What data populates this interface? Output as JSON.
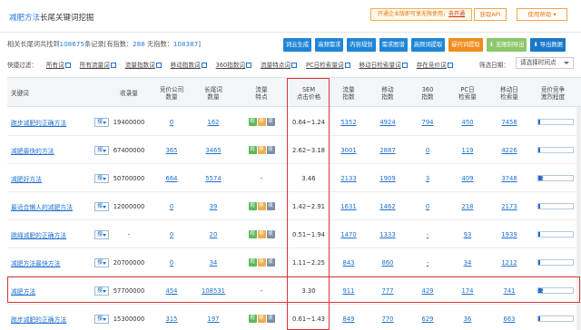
{
  "header": {
    "title_highlight": "减肥方法",
    "title_rest": "长尾关键词挖掘",
    "promo_text": "开通企业版即可享无限使用，",
    "promo_link": "去开通",
    "api_button": "获取API",
    "help_button": "使用帮助"
  },
  "summary": {
    "prefix": "相关长尾词共找到",
    "total": "108675",
    "middle": "条记录[有指数：",
    "with_index": "288",
    "middle2": " 无指数：",
    "without_index": "108387",
    "suffix": "]"
  },
  "actions": [
    "词云生成",
    "高频需求",
    "内容规划",
    "需求图谱",
    "高频词提取",
    "疑问词提取",
    "无限制导出",
    "导出数据"
  ],
  "filters": {
    "label": "快捷过滤：",
    "items": [
      "所有词",
      "所有流量词",
      "流量指数词",
      "移动指数词",
      "360指数词",
      "流量特点词",
      "PC日检索量词",
      "移动日检索量词",
      "存在竞价词"
    ]
  },
  "sort": {
    "label": "筛选日期：",
    "value": "请选择时间点"
  },
  "columns": {
    "keyword": "关键词",
    "records": "收录量",
    "bid_count": "竞价公司\n数量",
    "longtail": "长尾词\n数量",
    "traffic_feature": "流量\n特点",
    "sem": "SEM\n点击价格",
    "traffic_index": "流量\n指数",
    "mobile_index": "移动\n指数",
    "idx360": "360\n指数",
    "pc_daily": "PC日\n检索量",
    "mobile_daily": "移动日\n检索量",
    "competition": "竞价竞争\n激烈程度"
  },
  "rows": [
    {
      "keyword": "跑步减肥的正确方法",
      "dd": "搜",
      "records": "19400000",
      "bid": "0",
      "longtail": "162",
      "tags": [
        "视",
        "移",
        "夜"
      ],
      "sem": "0.64~1.24",
      "traffic": "5352",
      "mobile": "4924",
      "i360": "794",
      "pc": "450",
      "mdaily": "7458",
      "comp_label": "1",
      "comp": 0.06
    },
    {
      "keyword": "减肥最快的方法",
      "dd": "搜",
      "records": "67400000",
      "bid": "365",
      "longtail": "3465",
      "tags": [
        "视",
        "移",
        "夜"
      ],
      "sem": "2.62~3.18",
      "traffic": "3001",
      "mobile": "2887",
      "i360": "0",
      "pc": "119",
      "mdaily": "4226",
      "comp_label": "1",
      "comp": 0.06
    },
    {
      "keyword": "减肥好方法",
      "dd": "搜",
      "records": "50700000",
      "bid": "664",
      "longtail": "5574",
      "tags": [],
      "sem": "3.46",
      "traffic": "2133",
      "mobile": "1909",
      "i360": "3",
      "pc": "409",
      "mdaily": "3748",
      "comp_label": "2",
      "comp": 0.12
    },
    {
      "keyword": "最适合懒人的减肥方法",
      "dd": "搜",
      "records": "12000000",
      "bid": "0",
      "longtail": "39",
      "tags": [
        "视",
        "移",
        "夜"
      ],
      "sem": "1.42~2.91",
      "traffic": "1631",
      "mobile": "1462",
      "i360": "0",
      "pc": "218",
      "mdaily": "2173",
      "comp_label": "1",
      "comp": 0.06
    },
    {
      "keyword": "跳绳减肥的正确方法",
      "dd": "搜",
      "records": "-",
      "bid": "0",
      "longtail": "20",
      "tags": [
        "视",
        "移",
        "夜"
      ],
      "sem": "0.51~1.94",
      "traffic": "1470",
      "mobile": "1333",
      "i360": "-",
      "pc": "93",
      "mdaily": "1939",
      "comp_label": "1",
      "comp": 0.06
    },
    {
      "keyword": "减肥方法最快方法",
      "dd": "搜",
      "records": "20700000",
      "bid": "0",
      "longtail": "34",
      "tags": [
        "视",
        "移",
        "夜"
      ],
      "sem": "1.11~2.25",
      "traffic": "843",
      "mobile": "860",
      "i360": "-",
      "pc": "34",
      "mdaily": "1212",
      "comp_label": "1",
      "comp": 0.06
    },
    {
      "keyword": "减肥方法",
      "dd": "搜",
      "records": "57700000",
      "bid": "454",
      "longtail": "108531",
      "tags": [],
      "sem": "3.30",
      "traffic": "911",
      "mobile": "777",
      "i360": "429",
      "pc": "174",
      "mdaily": "741",
      "comp_label": "2",
      "comp": 0.12
    },
    {
      "keyword": "跑步减肥的正确方法",
      "dd": "搜",
      "records": "15300000",
      "bid": "315",
      "longtail": "197",
      "tags": [
        "视",
        "移",
        "夜"
      ],
      "sem": "0.61~1.43",
      "traffic": "849",
      "mobile": "770",
      "i360": "629",
      "pc": "36",
      "mdaily": "663",
      "comp_label": "1",
      "comp": 0.06
    }
  ]
}
